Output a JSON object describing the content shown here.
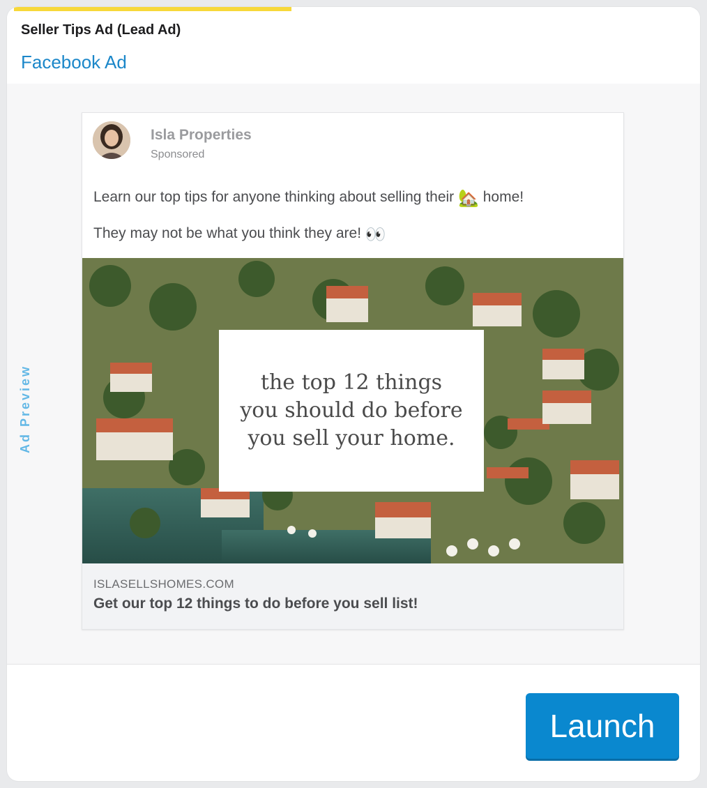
{
  "header": {
    "title": "Seller Tips Ad (Lead Ad)",
    "platform": "Facebook Ad",
    "progress_percent": 40,
    "progress_color": "#f7d83a"
  },
  "sidebar_label": "Ad Preview",
  "post": {
    "page_name": "Isla Properties",
    "sponsored": "Sponsored",
    "line1_text": "Learn our top tips for anyone thinking about selling their",
    "line1_emoji": "🏡",
    "line1_end": "home!",
    "line2_text": "They may not be what you think they are!",
    "line2_emoji": "👀",
    "overlay_lines": [
      "the top 12 things",
      "you should do before",
      "you sell your home."
    ],
    "link_domain": "ISLASELLSHOMES.COM",
    "link_headline": "Get our top 12 things to do before you sell list!"
  },
  "footer": {
    "launch_label": "Launch",
    "accent_color": "#0a88cf"
  }
}
